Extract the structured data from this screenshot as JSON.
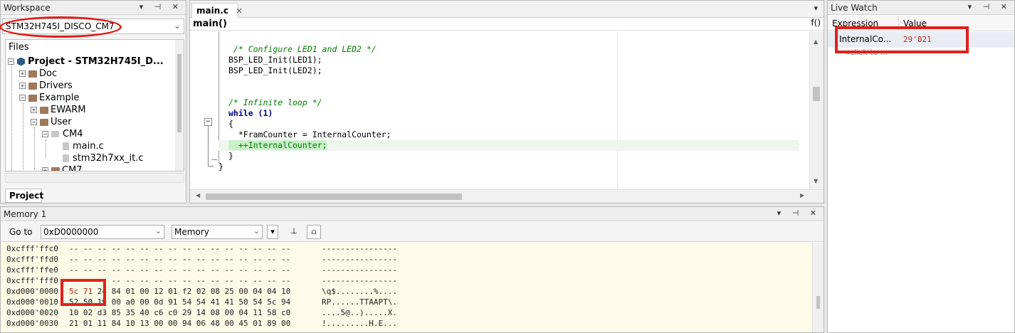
{
  "workspace": {
    "title": "Workspace",
    "controls": "▾ ⊣ ✕",
    "config": "STM32H745I_DISCO_CM7",
    "files_label": "Files",
    "tree": [
      {
        "label": "Project - STM32H745I_D...",
        "bold": true
      },
      {
        "label": "Doc"
      },
      {
        "label": "Drivers"
      },
      {
        "label": "Example"
      },
      {
        "label": "EWARM"
      },
      {
        "label": "User"
      },
      {
        "label": "CM4"
      },
      {
        "label": "main.c"
      },
      {
        "label": "stm32h7xx_it.c"
      },
      {
        "label": "CM7"
      }
    ],
    "tab": "Project"
  },
  "editor": {
    "tab_label": "main.c",
    "tab_close": "×",
    "tab_dropdown": "▾",
    "function": "main()",
    "function_icon": "f()",
    "lines": [
      {
        "text": " /* Configure LED1 and LED2 */",
        "style": "cmt"
      },
      {
        "text": "BSP_LED_Init(LED1);",
        "style": ""
      },
      {
        "text": "BSP_LED_Init(LED2);",
        "style": ""
      },
      {
        "text": "",
        "style": ""
      },
      {
        "text": "",
        "style": ""
      },
      {
        "text": "/* Infinite loop */",
        "style": "cmt"
      },
      {
        "text": "while (1)",
        "style": "kw"
      },
      {
        "text": "{",
        "style": ""
      },
      {
        "text": "  *FramCounter = InternalCounter;",
        "style": ""
      },
      {
        "text": "  ++InternalCounter;",
        "style": "hl"
      },
      {
        "text": "}",
        "style": ""
      },
      {
        "text": "}",
        "style": ""
      }
    ]
  },
  "livewatch": {
    "title": "Live Watch",
    "controls": "▾ ⊣ ✕",
    "col_expression": "Expression",
    "col_value": "Value",
    "row_expression": "InternalCo...",
    "row_value": "29'021",
    "row2_expression": "<click to ..."
  },
  "memory": {
    "title": "Memory 1",
    "controls": "▾ ⊣ ✕",
    "goto_label": "Go to",
    "goto_value": "0xD0000000",
    "zone_value": "Memory",
    "rows": [
      {
        "addr": "0xcfff'ffc0",
        "bytes": "-- -- -- -- -- -- -- -- -- -- -- -- -- -- -- --",
        "ascii": "----------------"
      },
      {
        "addr": "0xcfff'ffd0",
        "bytes": "-- -- -- -- -- -- -- -- -- -- -- -- -- -- -- --",
        "ascii": "----------------"
      },
      {
        "addr": "0xcfff'ffe0",
        "bytes": "-- -- -- -- -- -- -- -- -- -- -- -- -- -- -- --",
        "ascii": "----------------"
      },
      {
        "addr": "0xcfff'fff0",
        "bytes": "-- -- -- -- -- -- -- -- -- -- -- -- -- -- -- --",
        "ascii": "----------------"
      },
      {
        "addr": "0xd000'0000",
        "bytes_red": "5c 71",
        "bytes": " 24 84 01 00 12 01 f2 02 08 25 00 04 04 10",
        "ascii": "\\q$........%...."
      },
      {
        "addr": "0xd000'0010",
        "bytes": "52 50 19 00 a0 00 0d 91 54 54 41 41 50 54 5c 94",
        "ascii": "RP......TTAAPT\\."
      },
      {
        "addr": "0xd000'0020",
        "bytes": "10 02 d3 85 35 40 c6 c0 29 14 08 00 04 11 58 c0",
        "ascii": "....5@..).....X."
      },
      {
        "addr": "0xd000'0030",
        "bytes": "21 01 11 84 10 13 00 00 94 06 48 00 45 01 89 00",
        "ascii": "!.........H.E..."
      }
    ]
  }
}
